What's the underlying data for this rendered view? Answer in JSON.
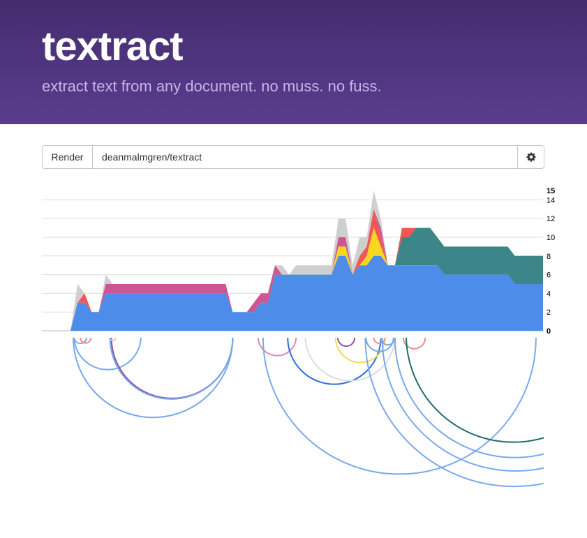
{
  "header": {
    "title": "textract",
    "tagline": "extract text from any document. no muss. no fuss."
  },
  "toolbar": {
    "render_label": "Render",
    "repo_value": "deanmalmgren/textract",
    "settings_icon": "gear-icon"
  },
  "colors": {
    "header_top": "#432c6f",
    "header_bottom": "#5a3d8e",
    "tagline": "#c8b3ea",
    "gray": "#cfcfcf",
    "red": "#f25757",
    "pink": "#cf5590",
    "yellow": "#f7d81f",
    "teal": "#3c8689",
    "blue": "#4e8cea",
    "arc_blue": "#78a9ec",
    "arc_dark_blue": "#2a6fd6",
    "arc_purple": "#8b52ad",
    "arc_dark_teal": "#1f6b6b",
    "arc_pink": "#d88ab7",
    "arc_salmon": "#ee8b8b",
    "arc_light_gray": "#dddddd",
    "arc_yellow": "#f4d95a"
  },
  "chart_data": {
    "type": "area",
    "stacked": true,
    "y_ticks": [
      0,
      2,
      4,
      6,
      8,
      10,
      12,
      14,
      15
    ],
    "bold_ticks": [
      0,
      15
    ],
    "ylim": [
      0,
      15
    ],
    "grid": true,
    "x": [
      0,
      1,
      2,
      3,
      4,
      5,
      6,
      7,
      8,
      9,
      10,
      11,
      12,
      13,
      14,
      15,
      16,
      17,
      18,
      19,
      20,
      21,
      22,
      23,
      24,
      25,
      26,
      27,
      28,
      29,
      30,
      31,
      32,
      33,
      34,
      35,
      36,
      37,
      38,
      39,
      40,
      41,
      42,
      43,
      44,
      45,
      46,
      47,
      48,
      49,
      50,
      51,
      52,
      53,
      54,
      55,
      56,
      57,
      58,
      59,
      60,
      61,
      62,
      63,
      64,
      65,
      66,
      67
    ],
    "series": [
      {
        "color": "#4e8cea",
        "values": [
          0,
          3,
          3,
          2,
          2,
          4,
          4,
          4,
          4,
          4,
          4,
          4,
          4,
          4,
          4,
          4,
          4,
          4,
          4,
          4,
          4,
          4,
          4,
          2,
          2,
          2,
          2,
          3,
          3,
          6,
          6,
          6,
          6,
          6,
          6,
          6,
          6,
          6,
          8,
          8,
          6,
          7,
          7,
          8,
          8,
          7,
          7,
          7,
          7,
          7,
          7,
          7,
          7,
          6,
          6,
          6,
          6,
          6,
          6,
          6,
          6,
          6,
          6,
          5,
          5,
          5,
          5,
          5
        ]
      },
      {
        "color": "#3c8689",
        "values": [
          0,
          0,
          0,
          0,
          0,
          0,
          0,
          0,
          0,
          0,
          0,
          0,
          0,
          0,
          0,
          0,
          0,
          0,
          0,
          0,
          0,
          0,
          0,
          0,
          0,
          0,
          0,
          0,
          0,
          0,
          0,
          0,
          0,
          0,
          0,
          0,
          0,
          0,
          0,
          0,
          0,
          0,
          0,
          0,
          0,
          0,
          0,
          3,
          3,
          4,
          4,
          4,
          3,
          3,
          3,
          3,
          3,
          3,
          3,
          3,
          3,
          3,
          3,
          3,
          3,
          3,
          3,
          3
        ]
      },
      {
        "color": "#f7d81f",
        "values": [
          0,
          0,
          0,
          0,
          0,
          0,
          0,
          0,
          0,
          0,
          0,
          0,
          0,
          0,
          0,
          0,
          0,
          0,
          0,
          0,
          0,
          0,
          0,
          0,
          0,
          0,
          0,
          0,
          0,
          0,
          0,
          0,
          0,
          0,
          0,
          0,
          0,
          0,
          1,
          1,
          0,
          0,
          1,
          3,
          1,
          0,
          0,
          0,
          0,
          0,
          0,
          0,
          0,
          0,
          0,
          0,
          0,
          0,
          0,
          0,
          0,
          0,
          0,
          0,
          0,
          0,
          0,
          0
        ]
      },
      {
        "color": "#f25757",
        "values": [
          0,
          0,
          1,
          0,
          0,
          0,
          0,
          0,
          0,
          0,
          0,
          0,
          0,
          0,
          0,
          0,
          0,
          0,
          0,
          0,
          0,
          0,
          0,
          0,
          0,
          0,
          0,
          0,
          0,
          0,
          0,
          0,
          0,
          0,
          0,
          0,
          0,
          0,
          0,
          0,
          0,
          1,
          1,
          2,
          1,
          0,
          0,
          1,
          1,
          0,
          0,
          0,
          0,
          0,
          0,
          0,
          0,
          0,
          0,
          0,
          0,
          0,
          0,
          0,
          0,
          0,
          0,
          0
        ]
      },
      {
        "color": "#cf5590",
        "values": [
          0,
          0,
          0,
          0,
          0,
          1,
          1,
          1,
          1,
          1,
          1,
          1,
          1,
          1,
          1,
          1,
          1,
          1,
          1,
          1,
          1,
          1,
          1,
          0,
          0,
          0,
          1,
          1,
          1,
          1,
          0,
          0,
          0,
          0,
          0,
          0,
          0,
          0,
          1,
          1,
          0,
          0,
          0,
          0,
          1,
          0,
          0,
          0,
          0,
          0,
          0,
          0,
          0,
          0,
          0,
          0,
          0,
          0,
          0,
          0,
          0,
          0,
          0,
          0,
          0,
          0,
          0,
          0
        ]
      },
      {
        "color": "#cfcfcf",
        "values": [
          0,
          2,
          0,
          0,
          0,
          1,
          0,
          0,
          0,
          0,
          0,
          0,
          0,
          0,
          0,
          0,
          0,
          0,
          0,
          0,
          0,
          0,
          0,
          0,
          0,
          0,
          0,
          0,
          0,
          0,
          1,
          0,
          1,
          1,
          1,
          1,
          1,
          1,
          2,
          2,
          1,
          2,
          1,
          2,
          1,
          0,
          0,
          0,
          0,
          0,
          0,
          0,
          0,
          0,
          0,
          0,
          0,
          0,
          0,
          0,
          0,
          0,
          0,
          0,
          0,
          0,
          0,
          0
        ]
      }
    ],
    "arcs": [
      {
        "from": 0.5,
        "to": 2.3,
        "color": "#78a9ec"
      },
      {
        "from": 1.4,
        "to": 2.9,
        "color": "#ee8b8b"
      },
      {
        "from": 0.4,
        "to": 23,
        "color": "#78a9ec"
      },
      {
        "from": 0.5,
        "to": 10,
        "color": "#78a9ec"
      },
      {
        "from": 5.8,
        "to": 23,
        "color": "#8b52ad"
      },
      {
        "from": 5.6,
        "to": 6.4,
        "color": "#cfcfcf"
      },
      {
        "from": 5.6,
        "to": 23,
        "color": "#78a9ec"
      },
      {
        "from": 26.6,
        "to": 32,
        "color": "#d88ab7"
      },
      {
        "from": 27.3,
        "to": 66,
        "color": "#78a9ec"
      },
      {
        "from": 30.8,
        "to": 44,
        "color": "#2a6fd6"
      },
      {
        "from": 33.3,
        "to": 46,
        "color": "#dddddd"
      },
      {
        "from": 37.9,
        "to": 40.3,
        "color": "#8b52ad"
      },
      {
        "from": 37.6,
        "to": 44.6,
        "color": "#f4d95a"
      },
      {
        "from": 41.9,
        "to": 45.8,
        "color": "#78a9ec"
      },
      {
        "from": 43,
        "to": 44.6,
        "color": "#ee8b8b"
      },
      {
        "from": 44,
        "to": 46,
        "color": "#78a9ec"
      },
      {
        "from": 47.2,
        "to": 50.3,
        "color": "#ee8b8b"
      },
      {
        "from": 41.8,
        "to": 84,
        "color": "#78a9ec"
      },
      {
        "from": 44.2,
        "to": 82,
        "color": "#78a9ec"
      },
      {
        "from": 46,
        "to": 80,
        "color": "#78a9ec"
      },
      {
        "from": 47.6,
        "to": 78,
        "color": "#1f6b6b"
      }
    ]
  }
}
